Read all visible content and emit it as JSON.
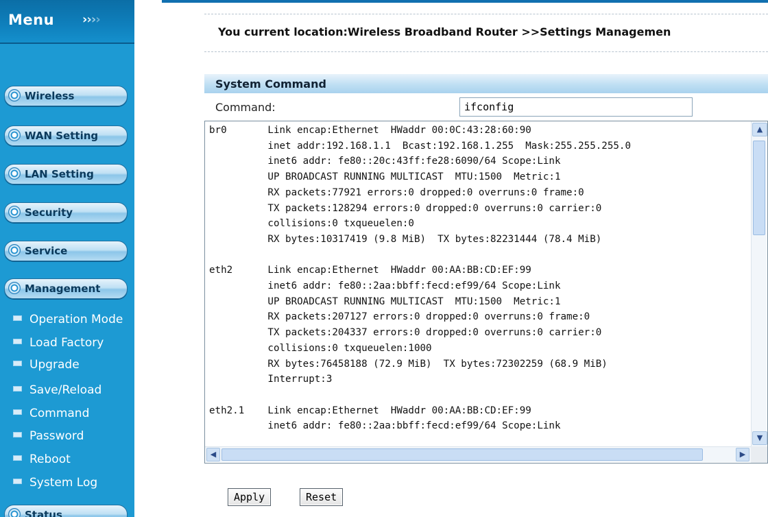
{
  "menu": {
    "title": "Menu",
    "arrows": [
      "›",
      "›",
      "›",
      "›"
    ],
    "categories": {
      "wireless": "Wireless",
      "wan": "WAN Setting",
      "lan": "LAN Setting",
      "security": "Security",
      "service": "Service",
      "management": "Management",
      "status": "Status"
    },
    "management_items": [
      "Operation Mode",
      "Load Factory",
      "Upgrade",
      "Save/Reload",
      "Command",
      "Password",
      "Reboot",
      "System Log"
    ]
  },
  "location": {
    "text": "You current location:Wireless Broadband Router >>Settings Managemen"
  },
  "section": {
    "title": "System Command"
  },
  "command": {
    "label": "Command:",
    "value": "ifconfig"
  },
  "output_lines": [
    "br0       Link encap:Ethernet  HWaddr 00:0C:43:28:60:90",
    "          inet addr:192.168.1.1  Bcast:192.168.1.255  Mask:255.255.255.0",
    "          inet6 addr: fe80::20c:43ff:fe28:6090/64 Scope:Link",
    "          UP BROADCAST RUNNING MULTICAST  MTU:1500  Metric:1",
    "          RX packets:77921 errors:0 dropped:0 overruns:0 frame:0",
    "          TX packets:128294 errors:0 dropped:0 overruns:0 carrier:0",
    "          collisions:0 txqueuelen:0",
    "          RX bytes:10317419 (9.8 MiB)  TX bytes:82231444 (78.4 MiB)",
    "",
    "eth2      Link encap:Ethernet  HWaddr 00:AA:BB:CD:EF:99",
    "          inet6 addr: fe80::2aa:bbff:fecd:ef99/64 Scope:Link",
    "          UP BROADCAST RUNNING MULTICAST  MTU:1500  Metric:1",
    "          RX packets:207127 errors:0 dropped:0 overruns:0 frame:0",
    "          TX packets:204337 errors:0 dropped:0 overruns:0 carrier:0",
    "          collisions:0 txqueuelen:1000",
    "          RX bytes:76458188 (72.9 MiB)  TX bytes:72302259 (68.9 MiB)",
    "          Interrupt:3",
    "",
    "eth2.1    Link encap:Ethernet  HWaddr 00:AA:BB:CD:EF:99",
    "          inet6 addr: fe80::2aa:bbff:fecd:ef99/64 Scope:Link"
  ],
  "buttons": {
    "apply": "Apply",
    "reset": "Reset"
  },
  "colors": {
    "sidebar_bg": "#1d9ad3",
    "header_bg": "#0f80bd",
    "section_header": "#bfdff3"
  }
}
